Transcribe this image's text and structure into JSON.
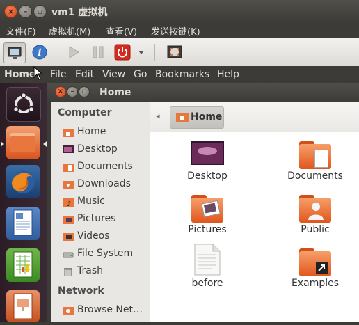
{
  "vm_window": {
    "title": "vm1 虚拟机",
    "menus": [
      "文件(F)",
      "虚拟机(M)",
      "查看(V)",
      "发送按键(K)"
    ]
  },
  "toolbar": {
    "buttons": [
      "monitor-icon",
      "info-icon",
      "play-icon",
      "pause-icon",
      "power-icon",
      "dropdown-arrow-icon",
      "fullscreen-icon"
    ]
  },
  "guest_menubar": {
    "app": "Home",
    "menus": [
      "File",
      "Edit",
      "View",
      "Go",
      "Bookmarks",
      "Help"
    ]
  },
  "nautilus": {
    "title": "Home",
    "sidebar": {
      "computer_header": "Computer",
      "items": [
        "Home",
        "Desktop",
        "Documents",
        "Downloads",
        "Music",
        "Pictures",
        "Videos",
        "File System",
        "Trash"
      ],
      "network_header": "Network",
      "network_items": [
        "Browse Net…"
      ]
    },
    "pathbar": {
      "current": "Home"
    },
    "files": [
      "Desktop",
      "Documents",
      "Pictures",
      "Public",
      "before",
      "Examples"
    ]
  },
  "colors": {
    "accent": "#e0561d",
    "launcher": "#2c1c26",
    "titlebar": "#3c3b37"
  }
}
